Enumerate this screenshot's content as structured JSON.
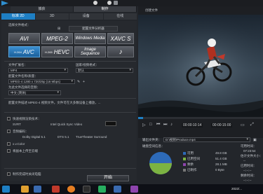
{
  "app": {
    "main_tabs": [
      "捕获",
      "制作"
    ],
    "active_main_tab": 1,
    "right_title": "创建文件"
  },
  "sub_tabs": [
    {
      "label": "标准 2D",
      "active": true
    },
    {
      "label": "3D",
      "active": false
    },
    {
      "label": "设备",
      "active": false
    },
    {
      "label": "在线",
      "active": false
    }
  ],
  "file_format": {
    "label": "选择文件格式：",
    "custom_button": "配置文件分析器",
    "formats": [
      {
        "label": "AVI",
        "selected": false
      },
      {
        "label": "MPEG-2",
        "selected": false
      },
      {
        "label": "Windows Media",
        "selected": false
      },
      {
        "label": "XAVC S",
        "selected": false
      },
      {
        "label": "AVC",
        "prefix": "H.264",
        "selected": true
      },
      {
        "label": "HEVC",
        "prefix": "H.265",
        "selected": false
      },
      {
        "label": "Image Sequence",
        "selected": false
      },
      {
        "label": "♪",
        "selected": false
      }
    ]
  },
  "settings": {
    "extension_label": "文件扩展名：",
    "extension_value": "MP4",
    "country_label": "国家/视频格式：",
    "country_value": "默认",
    "profile_label": "配置文件名称/质量：",
    "profile_value": "MPEG-4 1280 x 720/25p (16 Mbps)",
    "audio_label": "为此文件选择的音频：",
    "audio_value": "中文 (简体)"
  },
  "description": "配置文件描述 MPEG-4 视频文件。文件可在大多数设备上播放，...",
  "options": {
    "hw_encoder_label": "快速视频渲染技术：",
    "svrt_label": "SVRT",
    "intel_label": "Intel Quick Sync Video",
    "surround_label": "音频编码：",
    "dolby_label": "Dolby Digital 5.1",
    "dts_label": "DTS 5.1",
    "truetheater_label": "TrueTheater Surround",
    "xvcolor_label": "x.v.Color",
    "upload_label": "将副本上传至云端",
    "export_label": "制作完成时关闭电脑"
  },
  "start_button": "开始",
  "player": {
    "time_current": "00:00:10:14",
    "time_total": "00:00:15:00",
    "progress_fraction": 0.04
  },
  "output": {
    "path_label": "输出文件夹：",
    "path_value": "D:\\视频\\Produce.mp4",
    "disk_label": "磁盘空间信息：",
    "legend": [
      {
        "name": "可用",
        "value": "49.8 GB",
        "color": "#2d6ab8"
      },
      {
        "name": "已用空间",
        "value": "51.4 GB",
        "color": "#7cb342"
      },
      {
        "name": "剩余",
        "value": "28.1 MB",
        "color": "#8e44ad"
      },
      {
        "name": "已制作",
        "value": "0 Byte",
        "color": "#777777"
      }
    ],
    "stats": [
      {
        "label": "可用时间：",
        "value": "07:23:54"
      },
      {
        "label": "估计文件大小：",
        "value": "--"
      },
      {
        "label": "已用时间：",
        "value": "--:--:--"
      },
      {
        "label": "剩余时间：",
        "value": "--:--:--"
      }
    ]
  },
  "taskbar": {
    "time": "2022/..."
  },
  "colors": {
    "accent": "#1e7fc4",
    "panel": "#26292e",
    "background": "#1a1c20"
  }
}
